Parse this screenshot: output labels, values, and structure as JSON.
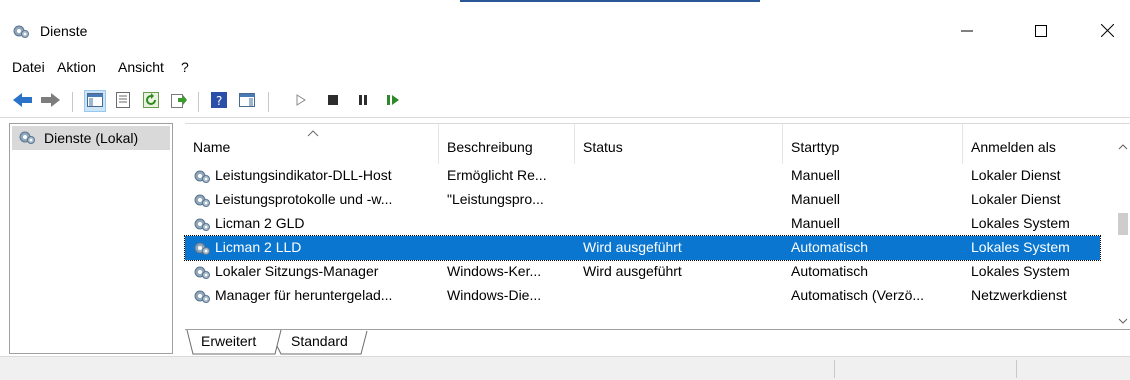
{
  "window": {
    "title": "Dienste",
    "app_icon": "services-gear-icon"
  },
  "window_controls": {
    "minimize": "minimize-icon",
    "maximize": "maximize-icon",
    "close": "close-icon"
  },
  "menu": [
    "Datei",
    "Aktion",
    "Ansicht",
    "?"
  ],
  "toolbar": [
    {
      "name": "back-icon"
    },
    {
      "name": "forward-icon"
    },
    {
      "name": "show-hide-console-tree-icon"
    },
    {
      "name": "properties-icon"
    },
    {
      "name": "refresh-icon"
    },
    {
      "name": "export-list-icon"
    },
    {
      "name": "help-icon"
    },
    {
      "name": "show-hide-action-pane-icon"
    },
    {
      "name": "start-service-icon"
    },
    {
      "name": "stop-service-icon"
    },
    {
      "name": "pause-service-icon"
    },
    {
      "name": "resume-service-icon"
    }
  ],
  "tree": {
    "root": "Dienste (Lokal)"
  },
  "columns": [
    "Name",
    "Beschreibung",
    "Status",
    "Starttyp",
    "Anmelden als"
  ],
  "rows": [
    {
      "name": "Leistungsindikator-DLL-Host",
      "description": "Ermöglicht Re...",
      "status": "",
      "startup": "Manuell",
      "logon": "Lokaler Dienst"
    },
    {
      "name": "Leistungsprotokolle und -w...",
      "description": "\"Leistungspro...",
      "status": "",
      "startup": "Manuell",
      "logon": "Lokaler Dienst"
    },
    {
      "name": "Licman 2 GLD",
      "description": "",
      "status": "",
      "startup": "Manuell",
      "logon": "Lokales System"
    },
    {
      "name": "Licman 2 LLD",
      "description": "",
      "status": "Wird ausgeführt",
      "startup": "Automatisch",
      "logon": "Lokales System",
      "selected": true
    },
    {
      "name": "Lokaler Sitzungs-Manager",
      "description": "Windows-Ker...",
      "status": "Wird ausgeführt",
      "startup": "Automatisch",
      "logon": "Lokales System"
    },
    {
      "name": "Manager für heruntergelad...",
      "description": "Windows-Die...",
      "status": "",
      "startup": "Automatisch (Verzö...",
      "logon": "Netzwerkdienst"
    }
  ],
  "tabs": [
    "Erweitert",
    "Standard"
  ],
  "active_tab": "Standard",
  "colors": {
    "selection": "#0a76cf",
    "titlebar_accent": "#2b5797"
  }
}
